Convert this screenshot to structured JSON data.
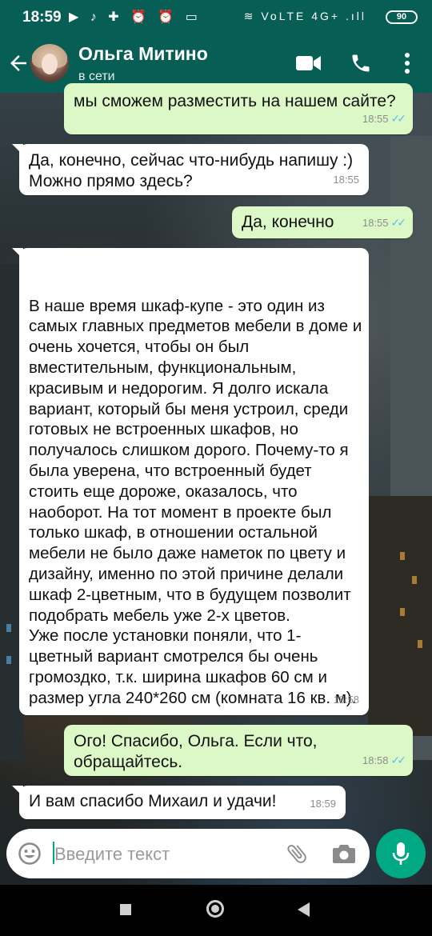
{
  "status_bar": {
    "time": "18:59",
    "left_icons": "▶ ♪ ✚ ⏰ ⏰ ▭",
    "right_icons": "≋ VoLTE 4G+ .ıll",
    "battery": "90"
  },
  "header": {
    "contact_name": "Ольга Митино",
    "status": "в сети"
  },
  "messages": [
    {
      "direction": "out",
      "text": "мы сможем разместить на нашем сайте?",
      "time": "18:55",
      "read": true
    },
    {
      "direction": "in",
      "text": "Да, конечно, сейчас что-нибудь напишу :) Можно прямо здесь?",
      "time": "18:55"
    },
    {
      "direction": "out",
      "text": "Да, конечно",
      "time": "18:55",
      "read": true
    },
    {
      "direction": "in",
      "text": "В наше время шкаф-купе - это один из самых главных предметов мебели в доме и очень хочется, чтобы он был вместительным, функциональным, красивым и недорогим. Я долго искала вариант, который бы меня устроил, среди готовых не встроенных шкафов, но получалось слишком дорого. Почему-то я была уверена, что встроенный будет стоить еще дороже, оказалось, что наоборот. На тот момент в проекте был только шкаф, в отношении остальной мебели не было даже наметок по цвету и дизайну, именно по этой причине делали шкаф 2-цветным, что в будущем позволит подобрать мебель уже 2-х цветов.\nУже после установки поняли, что 1-цветный вариант смотрелся бы очень громоздко, т.к. ширина шкафов 60 см и размер угла 240*260 см (комната 16 кв. м).",
      "time": "18:58"
    },
    {
      "direction": "out",
      "text": "Ого! Спасибо, Ольга. Если что, обращайтесь.",
      "time": "18:58",
      "read": true
    },
    {
      "direction": "in",
      "text": "И вам спасибо Михаил и удачи!",
      "time": "18:59"
    }
  ],
  "composer": {
    "placeholder": "Введите текст"
  },
  "colors": {
    "header": "#075e54",
    "outgoing_bubble": "#dcf8c6",
    "incoming_bubble": "#ffffff",
    "accent": "#00a884",
    "read_ticks": "#4fc3f7"
  }
}
